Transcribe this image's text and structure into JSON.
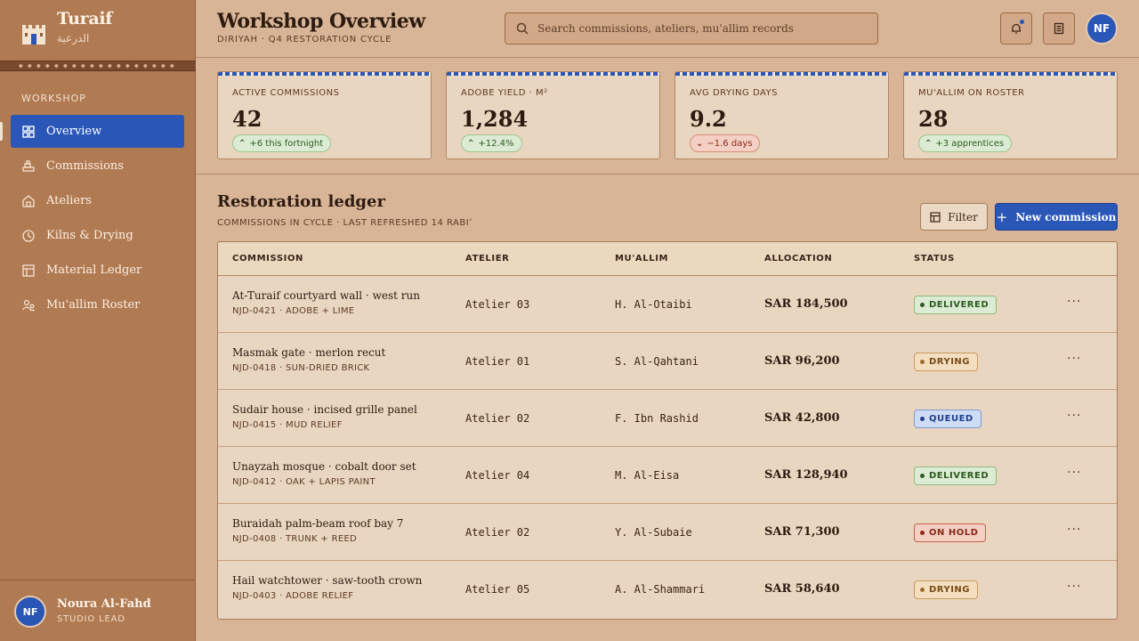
{
  "brand": {
    "name": "Turaif",
    "arabic": "الدرعية"
  },
  "sidebar": {
    "section_label": "WORKSHOP",
    "items": [
      {
        "label": "Overview",
        "icon": "grid-icon",
        "active": true
      },
      {
        "label": "Commissions",
        "icon": "bricks-icon",
        "active": false
      },
      {
        "label": "Ateliers",
        "icon": "house-icon",
        "active": false
      },
      {
        "label": "Kilns & Drying",
        "icon": "clock-icon",
        "active": false
      },
      {
        "label": "Material Ledger",
        "icon": "ledger-icon",
        "active": false
      },
      {
        "label": "Mu'allim Roster",
        "icon": "people-icon",
        "active": false
      }
    ],
    "user": {
      "initials": "NF",
      "name": "Noura Al-Fahd",
      "role": "STUDIO LEAD"
    }
  },
  "header": {
    "title": "Workshop Overview",
    "subtitle": "DIRIYAH · Q4 RESTORATION CYCLE",
    "search_placeholder": "Search commissions, ateliers, mu'allim records",
    "avatar_initials": "NF"
  },
  "kpis": [
    {
      "label": "ACTIVE COMMISSIONS",
      "value": "42",
      "delta": "+6 this fortnight",
      "trend": "up"
    },
    {
      "label": "ADOBE YIELD · M²",
      "value": "1,284",
      "delta": "+12.4%",
      "trend": "up"
    },
    {
      "label": "AVG DRYING DAYS",
      "value": "9.2",
      "delta": "−1.6 days",
      "trend": "down"
    },
    {
      "label": "MU'ALLIM ON ROSTER",
      "value": "28",
      "delta": "+3 apprentices",
      "trend": "up"
    }
  ],
  "ledger": {
    "title": "Restoration ledger",
    "subtitle": "COMMISSIONS IN CYCLE · LAST REFRESHED 14 RABIʻ",
    "filter_label": "Filter",
    "new_label": "New commission",
    "columns": [
      "COMMISSION",
      "ATELIER",
      "MU'ALLIM",
      "ALLOCATION",
      "STATUS"
    ],
    "rows": [
      {
        "title": "At-Turaif courtyard wall · west run",
        "code": "NJD-0421 · ADOBE + LIME",
        "atelier": "Atelier 03",
        "mualim": "H. Al-Otaibi",
        "allocation": "SAR 184,500",
        "status": "DELIVERED",
        "status_class": "b-delivered"
      },
      {
        "title": "Masmak gate · merlon recut",
        "code": "NJD-0418 · SUN-DRIED BRICK",
        "atelier": "Atelier 01",
        "mualim": "S. Al-Qahtani",
        "allocation": "SAR 96,200",
        "status": "DRYING",
        "status_class": "b-drying"
      },
      {
        "title": "Sudair house · incised grille panel",
        "code": "NJD-0415 · MUD RELIEF",
        "atelier": "Atelier 02",
        "mualim": "F. Ibn Rashid",
        "allocation": "SAR 42,800",
        "status": "QUEUED",
        "status_class": "b-queued"
      },
      {
        "title": "Unayzah mosque · cobalt door set",
        "code": "NJD-0412 · OAK + LAPIS PAINT",
        "atelier": "Atelier 04",
        "mualim": "M. Al-Eisa",
        "allocation": "SAR 128,940",
        "status": "DELIVERED",
        "status_class": "b-delivered"
      },
      {
        "title": "Buraidah palm-beam roof bay 7",
        "code": "NJD-0408 · TRUNK + REED",
        "atelier": "Atelier 02",
        "mualim": "Y. Al-Subaie",
        "allocation": "SAR 71,300",
        "status": "ON HOLD",
        "status_class": "b-hold"
      },
      {
        "title": "Hail watchtower · saw-tooth crown",
        "code": "NJD-0403 · ADOBE RELIEF",
        "atelier": "Atelier 05",
        "mualim": "A. Al-Shammari",
        "allocation": "SAR 58,640",
        "status": "DRYING",
        "status_class": "b-drying"
      }
    ]
  },
  "colors": {
    "accent": "#2a56b8",
    "sidebar": "#b07a52",
    "page": "#d8b596",
    "card": "#e9d6c0"
  }
}
